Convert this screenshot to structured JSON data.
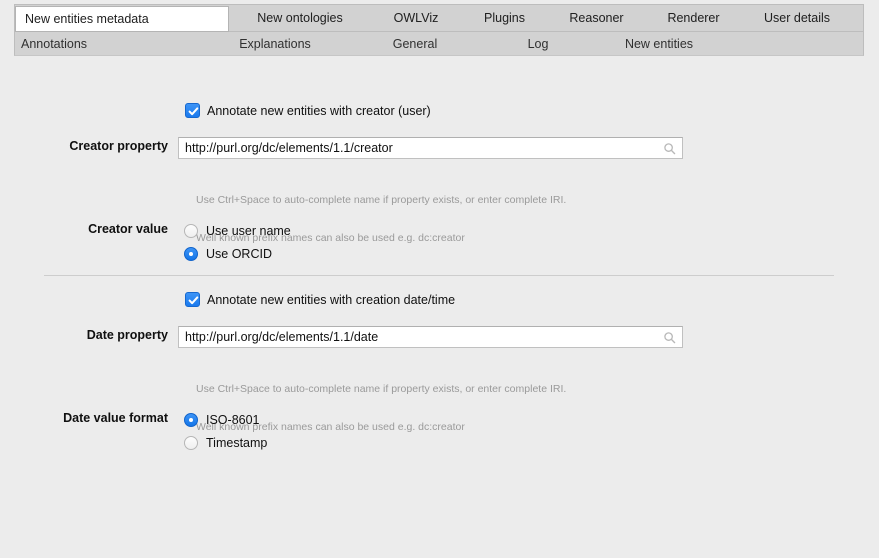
{
  "tabs_primary": [
    {
      "label": "New entities metadata",
      "selected": true
    },
    {
      "label": "New ontologies",
      "selected": false
    },
    {
      "label": "OWLViz",
      "selected": false
    },
    {
      "label": "Plugins",
      "selected": false
    },
    {
      "label": "Reasoner",
      "selected": false
    },
    {
      "label": "Renderer",
      "selected": false
    },
    {
      "label": "User details",
      "selected": false
    }
  ],
  "tabs_secondary": [
    {
      "label": "Annotations"
    },
    {
      "label": "Explanations"
    },
    {
      "label": "General"
    },
    {
      "label": "Log"
    },
    {
      "label": "New entities"
    }
  ],
  "creator_section": {
    "checkbox_label": "Annotate new entities with creator (user)",
    "checkbox_checked": true,
    "property_label": "Creator property",
    "property_value": "http://purl.org/dc/elements/1.1/creator",
    "property_icon": "search-icon",
    "hint_line1": "Use Ctrl+Space to auto-complete name if property exists, or enter complete IRI.",
    "hint_line2": "Well known prefix names can also be used e.g. dc:creator",
    "value_label": "Creator value",
    "options": [
      {
        "label": "Use user name",
        "selected": false
      },
      {
        "label": "Use ORCID",
        "selected": true
      }
    ]
  },
  "date_section": {
    "checkbox_label": "Annotate new entities with creation date/time",
    "checkbox_checked": true,
    "property_label": "Date property",
    "property_value": "http://purl.org/dc/elements/1.1/date",
    "property_icon": "search-icon",
    "hint_line1": "Use Ctrl+Space to auto-complete name if property exists, or enter complete IRI.",
    "hint_line2": "Well known prefix names can also be used e.g. dc:creator",
    "format_label": "Date value format",
    "options": [
      {
        "label": "ISO-8601",
        "selected": true
      },
      {
        "label": "Timestamp",
        "selected": false
      }
    ]
  },
  "colors": {
    "accent": "#1a7aee",
    "window_bg": "#ececec",
    "tabbar_bg": "#d2d2d2",
    "hint_text": "#9a9a9a"
  }
}
